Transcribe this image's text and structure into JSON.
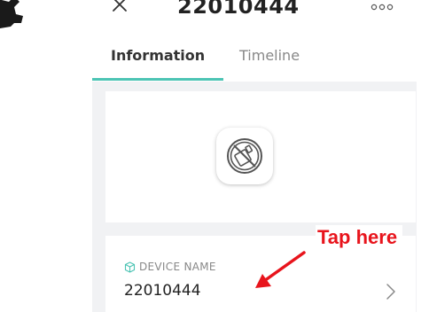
{
  "header": {
    "title": "22010444",
    "close_icon": "close-icon",
    "more_icon": "more-dots-icon"
  },
  "tabs": [
    {
      "label": "Information",
      "active": true
    },
    {
      "label": "Timeline",
      "active": false
    }
  ],
  "device": {
    "icon": "device-disconnected-icon"
  },
  "name_card": {
    "label": "DEVICE NAME",
    "value": "22010444",
    "label_icon": "cube-icon",
    "chevron_icon": "chevron-right-icon"
  },
  "annotation": {
    "text": "Tap here",
    "color": "#e8141c"
  },
  "colors": {
    "accent": "#4cc4b4",
    "background": "#f1f2f4"
  }
}
